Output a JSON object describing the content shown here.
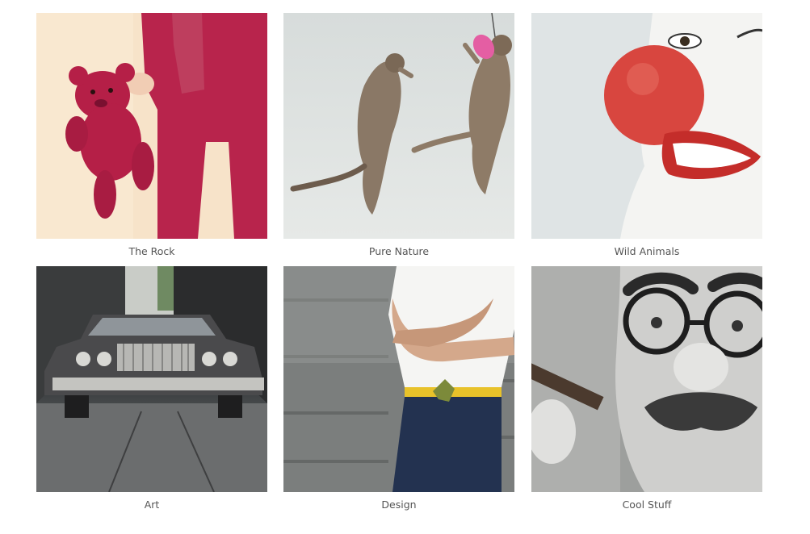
{
  "gallery": {
    "items": [
      {
        "caption": "The Rock",
        "image": "teddy-bear-photo"
      },
      {
        "caption": "Pure Nature",
        "image": "jumping-cats-photo"
      },
      {
        "caption": "Wild Animals",
        "image": "clown-nose-photo"
      },
      {
        "caption": "Art",
        "image": "vintage-car-photo"
      },
      {
        "caption": "Design",
        "image": "man-with-crossed-arms-photo"
      },
      {
        "caption": "Cool Stuff",
        "image": "groucho-glasses-photo"
      }
    ]
  }
}
